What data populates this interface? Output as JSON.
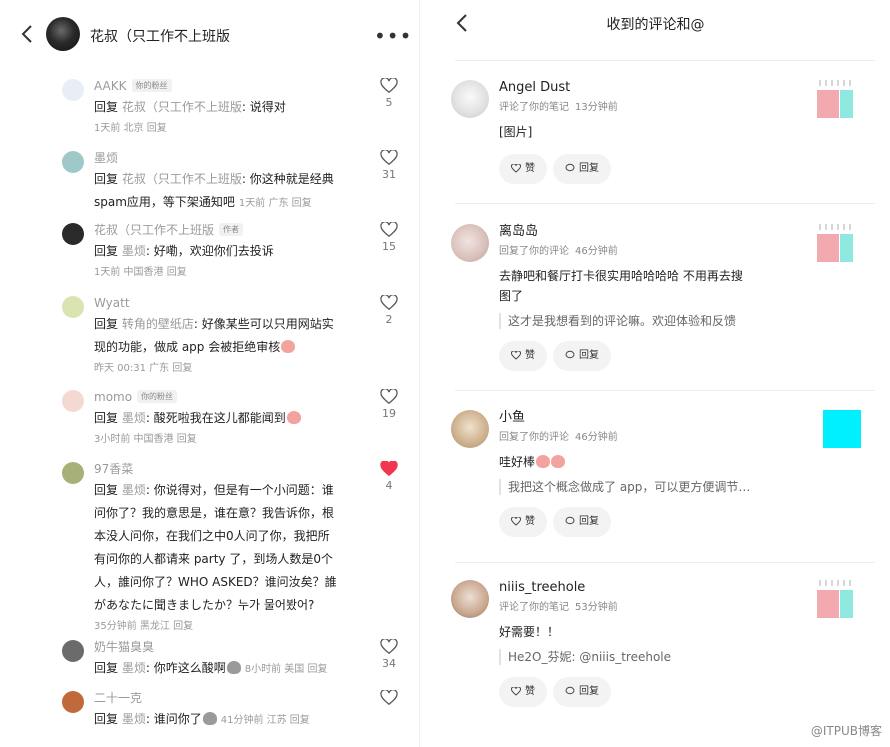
{
  "left": {
    "title": "花叔（只工作不上班版",
    "comments": [
      {
        "name": "AAKK",
        "tag": "你的粉丝",
        "reply": "回复",
        "target": "花叔（只工作不上班版",
        "text": ": 说得对",
        "meta": "1天前 北京 回复",
        "likes": "5",
        "liked": false,
        "avatar_color": "#e8eef6"
      },
      {
        "name": "墨烦",
        "tag": "",
        "reply": "回复",
        "target": "花叔（只工作不上班版",
        "text": ": 你这种就是经典",
        "text2": "spam应用，等下架通知吧",
        "meta": "1天前 广东 回复",
        "likes": "31",
        "liked": false,
        "avatar_color": "#9fc9c8"
      },
      {
        "name": "花叔（只工作不上班版",
        "tag": "作者",
        "reply": "回复",
        "target": "墨烦",
        "text": ": 好嘞，欢迎你们去投诉",
        "meta": "1天前 中国香港 回复",
        "likes": "15",
        "liked": false,
        "avatar_color": "#2a2a2a"
      },
      {
        "name": "Wyatt",
        "tag": "",
        "reply": "回复",
        "target": "转角的壁纸店",
        "text": ": 好像某些可以只用网站实",
        "text2": "现的功能，做成 app 会被拒绝审核",
        "meta": "昨天 00:31 广东 回复",
        "likes": "2",
        "liked": false,
        "avatar_color": "#d9e4b0"
      },
      {
        "name": "momo",
        "tag": "你的粉丝",
        "reply": "回复",
        "target": "墨烦",
        "text": ": 酸死啦我在这儿都能闻到",
        "meta": "3小时前 中国香港 回复",
        "likes": "19",
        "liked": false,
        "avatar_color": "#f4d8d2"
      },
      {
        "name": "97香菜",
        "tag": "",
        "reply": "回复",
        "target": "墨烦",
        "text": ": 你说得对，但是有一个小问题：谁",
        "lines": [
          "问你了？我的意思是，谁在意？我告诉你，根",
          "本没人问你，在我们之中0人问了你，我把所",
          "有问你的人都请来 party 了，到场人数是0个",
          "人，誰问你了？WHO ASKED？谁问汝矣？誰",
          "があなたに聞きましたか？누가 물어봤어?"
        ],
        "meta": "35分钟前 黑龙江 回复",
        "likes": "4",
        "liked": true,
        "avatar_color": "#a8b07a"
      },
      {
        "name": "奶牛猫臭臭",
        "tag": "",
        "reply": "回复",
        "target": "墨烦",
        "text": ": 你咋这么酸啊",
        "meta": "8小时前 美国 回复",
        "likes": "34",
        "liked": false,
        "avatar_color": "#6b6b6b"
      },
      {
        "name": "二十一克",
        "tag": "",
        "reply": "回复",
        "target": "墨烦",
        "text": ": 谁问你了",
        "meta": "41分钟前 江苏 回复",
        "likes": "",
        "liked": false,
        "avatar_color": "#c06a3c"
      }
    ]
  },
  "right": {
    "title": "收到的评论和@",
    "like_label": "赞",
    "reply_label": "回复",
    "notifications": [
      {
        "name": "Angel Dust",
        "action": "评论了你的笔记",
        "time": "13分钟前",
        "text": "[图片]",
        "quote": "",
        "avatar_color": "#d8d8d8",
        "thumb": "pink-teal"
      },
      {
        "name": "离岛岛",
        "action": "回复了你的评论",
        "time": "46分钟前",
        "text": "去静吧和餐厅打卡很实用哈哈哈哈 不用再去搜",
        "text2": "图了",
        "quote": "这才是我想看到的评论嘛。欢迎体验和反馈",
        "avatar_color": "#e9d6d2",
        "thumb": "pink-teal"
      },
      {
        "name": "小鱼",
        "action": "回复了你的评论",
        "time": "46分钟前",
        "text": "哇好棒",
        "quote": "我把这个概念做成了 app，可以更方便调节…",
        "avatar_color": "#d9c2a5",
        "thumb": "cyan"
      },
      {
        "name": "niiis_treehole",
        "action": "评论了你的笔记",
        "time": "53分钟前",
        "text": "好需要！！",
        "quote": "He2O_芬妮: @niiis_treehole",
        "avatar_color": "#c9a78f",
        "thumb": "pink-teal"
      }
    ]
  },
  "watermark": "@ITPUB博客"
}
